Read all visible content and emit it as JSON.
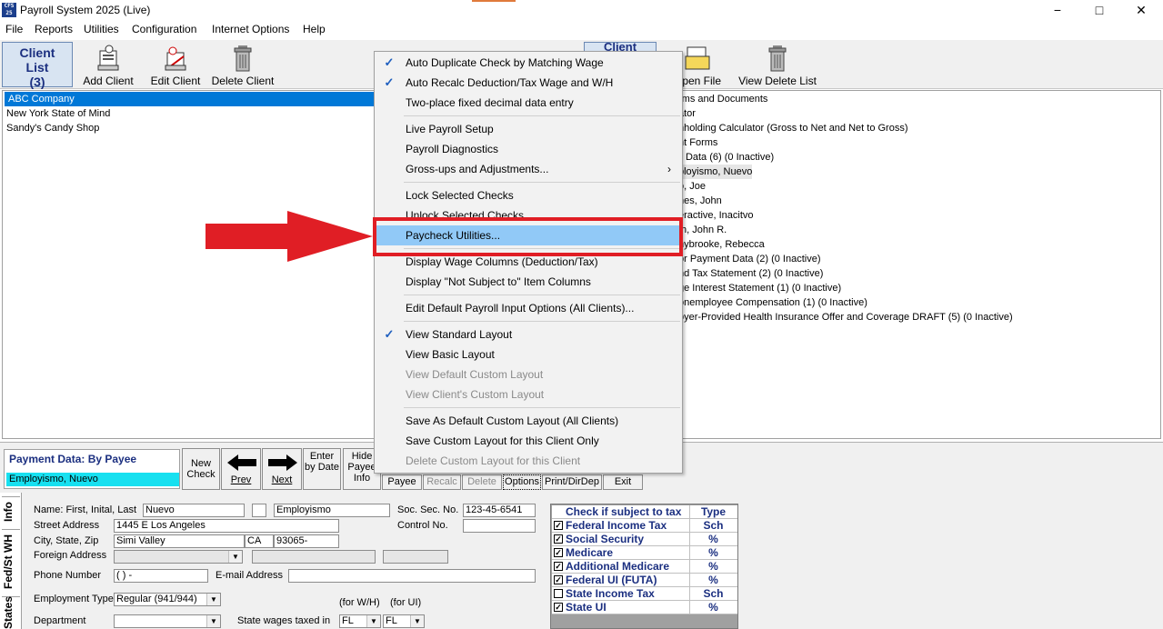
{
  "window": {
    "title": "Payroll System 2025 (Live)",
    "icon_text": "CFS 25",
    "minimize": "−",
    "maximize": "□",
    "close": "✕"
  },
  "menubar": [
    "File",
    "Reports",
    "Utilities",
    "Configuration",
    "Internet Options",
    "Help"
  ],
  "toolbar": {
    "client_list": {
      "l1": "Client",
      "l2": "List",
      "l3": "(3)"
    },
    "add_client": "Add Client",
    "edit_client": "Edit Client",
    "delete_client": "Delete Client",
    "client_tab": "Client",
    "open_file": "Open File",
    "view_delete_list": "View Delete List"
  },
  "clients": [
    "ABC Company",
    "New York State of Mind",
    "Sandy's Candy Shop"
  ],
  "right_items": [
    "rms and Documents",
    "ator",
    "nholding Calculator (Gross to Net and Net to Gross)",
    "nt Forms",
    "ll Data  (6) (0 Inactive)",
    "ployismo, Nuevo",
    "o, Joe",
    "nes, John",
    "eractive, Inacitvo",
    "th, John R.",
    "nybrooke, Rebecca",
    "or Payment Data  (2) (0 Inactive)",
    "nd Tax Statement  (2) (0 Inactive)",
    "ge Interest Statement  (1) (0 Inactive)",
    "onemployee Compensation  (1) (0 Inactive)",
    "oyer-Provided Health Insurance Offer and Coverage DRAFT  (5) (0 Inactive)"
  ],
  "menu": [
    {
      "label": "Auto Duplicate Check by Matching Wage",
      "checked": true
    },
    {
      "label": "Auto Recalc Deduction/Tax Wage and W/H",
      "checked": true
    },
    {
      "label": "Two-place fixed decimal data entry"
    },
    {
      "sep": true
    },
    {
      "label": "Live Payroll Setup"
    },
    {
      "label": "Payroll Diagnostics"
    },
    {
      "label": "Gross-ups and Adjustments...",
      "submenu": true
    },
    {
      "sep": true
    },
    {
      "label": "Lock Selected Checks"
    },
    {
      "label": "Unlock Selected Checks"
    },
    {
      "label": "Paycheck Utilities...",
      "highlighted": true
    },
    {
      "sep": true
    },
    {
      "label": "Display Wage Columns (Deduction/Tax)"
    },
    {
      "label": "Display \"Not Subject to\" Item Columns"
    },
    {
      "sep": true
    },
    {
      "label": "Edit Default Payroll Input Options (All Clients)..."
    },
    {
      "sep": true
    },
    {
      "label": "View Standard Layout",
      "checked": true
    },
    {
      "label": "View Basic Layout"
    },
    {
      "label": "View Default Custom Layout",
      "disabled": true
    },
    {
      "label": "View Client's Custom Layout",
      "disabled": true
    },
    {
      "sep": true
    },
    {
      "label": "Save As Default Custom Layout (All Clients)"
    },
    {
      "label": "Save Custom Layout for this Client Only"
    },
    {
      "label": "Delete Custom Layout for this Client",
      "disabled": true
    }
  ],
  "payment": {
    "heading": "Payment Data:  By Payee",
    "payee": "Employismo, Nuevo",
    "new_check": "New Check",
    "prev": "Prev",
    "next": "Next",
    "enter_by_date": "Enter by Date",
    "hide_payee_info": "Hide Payee Info",
    "payee_btn": "Payee",
    "recalc": "Recalc",
    "delete": "Delete",
    "options": "Options",
    "print": "Print/DirDep",
    "exit": "Exit"
  },
  "tabs": {
    "info": "Info",
    "fed": "Fed/St WH",
    "states": "States"
  },
  "form": {
    "name_label": "Name: First, Inital, Last",
    "first": "Nuevo",
    "last": "Employismo",
    "ssn_label": "Soc. Sec. No.",
    "ssn": "123-45-6541",
    "street_label": "Street Address",
    "street": "1445 E Los Angeles",
    "control_label": "Control No.",
    "city_label": "City, State, Zip",
    "city": "Simi Valley",
    "state": "CA",
    "zip": "93065-",
    "foreign_label": "Foreign Address",
    "phone_label": "Phone Number",
    "phone": "(   )    -",
    "email_label": "E-mail Address",
    "emp_type_label": "Employment Type",
    "emp_type": "Regular (941/944)",
    "dept_label": "Department",
    "state_wages_label": "State wages taxed in",
    "for_wh": "(for W/H)",
    "for_ui": "(for UI)",
    "wh_state": "FL",
    "ui_state": "FL"
  },
  "tax": {
    "header": "Check if subject to tax",
    "type_header": "Type",
    "rows": [
      {
        "name": "Federal Income Tax",
        "type": "Sch",
        "checked": true
      },
      {
        "name": "Social Security",
        "type": "%",
        "checked": true
      },
      {
        "name": "Medicare",
        "type": "%",
        "checked": true
      },
      {
        "name": "Additional Medicare",
        "type": "%",
        "checked": true
      },
      {
        "name": "Federal UI (FUTA)",
        "type": "%",
        "checked": true
      },
      {
        "name": "State Income Tax",
        "type": "Sch",
        "checked": false
      },
      {
        "name": "State UI",
        "type": "%",
        "checked": true
      }
    ]
  },
  "colors": {
    "accent": "#0078d7",
    "highlight": "#91c9f7",
    "annotation_red": "#e01e25",
    "payee_bg": "#17e0f0"
  }
}
